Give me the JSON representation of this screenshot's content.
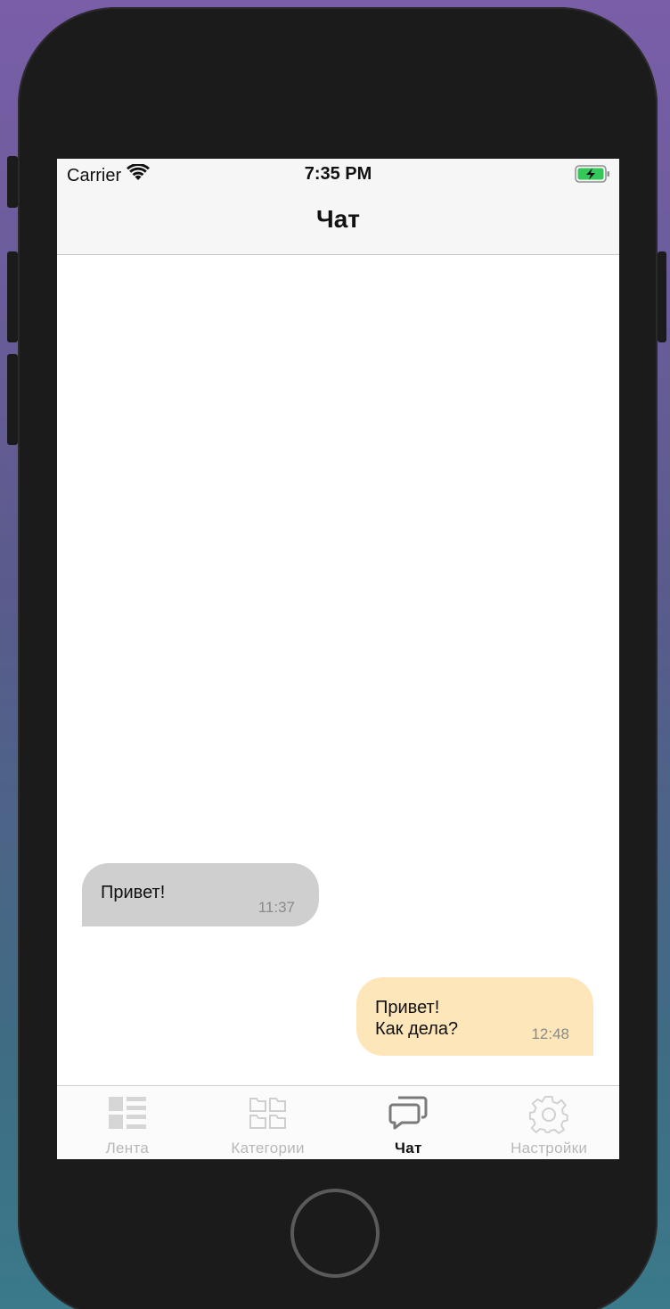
{
  "status_bar": {
    "carrier": "Carrier",
    "time": "7:35 PM",
    "battery_color": "#34c759"
  },
  "nav": {
    "title": "Чат"
  },
  "messages": [
    {
      "direction": "incoming",
      "lines": [
        "Привет!"
      ],
      "time": "11:37",
      "bubble_color": "#cfcfcf"
    },
    {
      "direction": "outgoing",
      "lines": [
        "Привет!",
        "Как дела?"
      ],
      "time": "12:48",
      "bubble_color": "#fde6b9"
    }
  ],
  "tabs": [
    {
      "label": "Лента",
      "icon": "feed-icon",
      "active": false
    },
    {
      "label": "Категории",
      "icon": "categories-icon",
      "active": false
    },
    {
      "label": "Чат",
      "icon": "chat-icon",
      "active": true
    },
    {
      "label": "Настройки",
      "icon": "settings-gear-icon",
      "active": false
    }
  ]
}
